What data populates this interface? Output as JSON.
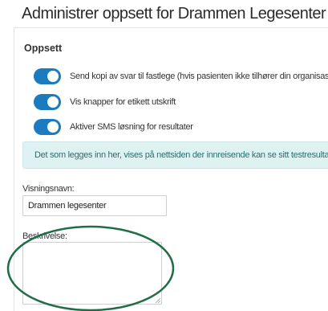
{
  "page": {
    "heading": "Administrer oppsett for Drammen Legesenter DA"
  },
  "settings": {
    "title": "Oppsett",
    "toggles": [
      {
        "label": "Send kopi av svar til fastlege (hvis pasienten ikke tilhører din organisasjon)",
        "on": true
      },
      {
        "label": "Vis knapper for etikett utskrift",
        "on": true
      },
      {
        "label": "Aktiver SMS løsning for resultater",
        "on": true
      }
    ],
    "info_text": "Det som legges inn her, vises på nettsiden der innreisende kan se sitt testresultat",
    "display_name": {
      "label": "Visningsnavn:",
      "value": "Drammen legesenter"
    },
    "description": {
      "label": "Beskrivelse:",
      "value": ""
    }
  },
  "colors": {
    "toggle_on": "#1c7bc0",
    "info_bg": "#dff2f2",
    "annotation": "#1f6e45"
  }
}
